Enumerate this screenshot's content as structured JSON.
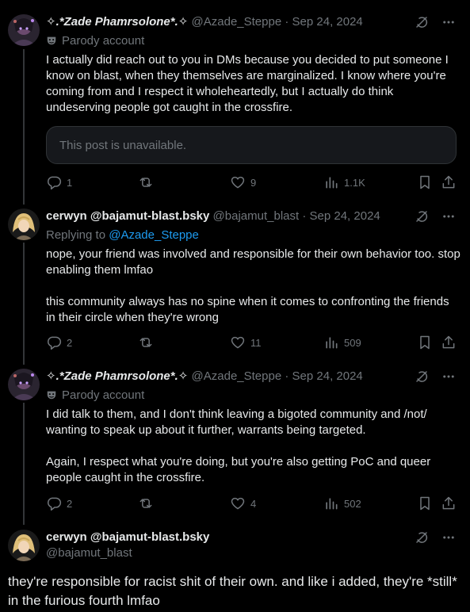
{
  "posts": [
    {
      "display_name": "✧.*Zade Phamrsolone*.✧",
      "handle": "@Azade_Steppe",
      "date": "Sep 24, 2024",
      "sep": "·",
      "label": "Parody account",
      "text": "I actually did reach out to you in DMs because you decided to put someone I know on blast, when they themselves are marginalized. I know where you're coming from and I respect it wholeheartedly, but I actually do think undeserving people got caught in the crossfire.",
      "quote_text": "This post is unavailable.",
      "replies": "1",
      "reposts": "",
      "likes": "9",
      "views": "1.1K"
    },
    {
      "display_name": "cerwyn @bajamut-blast.bsky",
      "handle": "@bajamut_blast",
      "date": "Sep 24, 2024",
      "sep": "·",
      "replying_prefix": "Replying to",
      "replying_to": "@Azade_Steppe",
      "text": "nope, your friend was involved and responsible for their own behavior too. stop enabling them lmfao\n\nthis community always has no spine when it comes to confronting the friends in their circle when they're wrong",
      "replies": "2",
      "reposts": "",
      "likes": "11",
      "views": "509"
    },
    {
      "display_name": "✧.*Zade Phamrsolone*.✧",
      "handle": "@Azade_Steppe",
      "date": "Sep 24, 2024",
      "sep": "·",
      "label": "Parody account",
      "text": "I did talk to them, and I don't think leaving a bigoted community and /not/ wanting to speak up about it further, warrants being targeted.\n\nAgain, I respect what you're doing, but you're also getting PoC and queer people caught in the crossfire.",
      "replies": "2",
      "reposts": "",
      "likes": "4",
      "views": "502"
    },
    {
      "display_name": "cerwyn @bajamut-blast.bsky",
      "handle": "@bajamut_blast",
      "text": "they're responsible for racist shit of their own. and like i added, they're *still* in the furious fourth lmfao"
    }
  ],
  "colors": {
    "background": "#000000",
    "text": "#e7e9ea",
    "muted": "#71767b",
    "link": "#1d9bf0",
    "border": "#2f3336"
  }
}
